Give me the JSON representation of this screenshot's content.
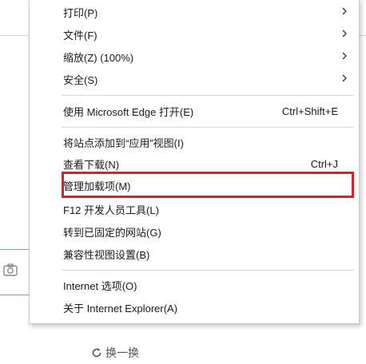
{
  "menu": {
    "items": [
      {
        "label": "打印(P)",
        "shortcut": "",
        "submenu": true
      },
      {
        "label": "文件(F)",
        "shortcut": "",
        "submenu": true
      },
      {
        "label": "缩放(Z) (100%)",
        "shortcut": "",
        "submenu": true
      },
      {
        "label": "安全(S)",
        "shortcut": "",
        "submenu": true
      },
      {
        "label": "使用 Microsoft Edge 打开(E)",
        "shortcut": "Ctrl+Shift+E",
        "submenu": false
      },
      {
        "label": "将站点添加到“应用”视图(I)",
        "shortcut": "",
        "submenu": false
      },
      {
        "label": "查看下载(N)",
        "shortcut": "Ctrl+J",
        "submenu": false
      },
      {
        "label": "管理加载项(M)",
        "shortcut": "",
        "submenu": false
      },
      {
        "label": "F12 开发人员工具(L)",
        "shortcut": "",
        "submenu": false
      },
      {
        "label": "转到已固定的网站(G)",
        "shortcut": "",
        "submenu": false
      },
      {
        "label": "兼容性视图设置(B)",
        "shortcut": "",
        "submenu": false
      },
      {
        "label": "Internet 选项(O)",
        "shortcut": "",
        "submenu": false
      },
      {
        "label": "关于 Internet Explorer(A)",
        "shortcut": "",
        "submenu": false
      }
    ]
  },
  "page": {
    "refresh_label": "换一换"
  },
  "colors": {
    "highlight": "#e02020",
    "input_border": "#7f9bd6"
  }
}
